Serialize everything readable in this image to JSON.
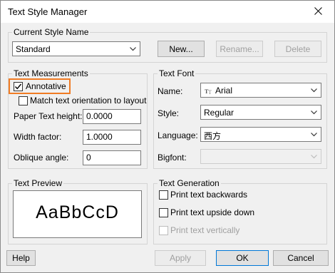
{
  "window": {
    "title": "Text Style Manager"
  },
  "icons": {
    "close": "close-icon",
    "dropdown": "chevron-down-icon",
    "check": "check-icon",
    "font": "truetype-font-icon"
  },
  "colors": {
    "highlight": "#f07c24",
    "default_button_border": "#0078d7"
  },
  "current_style": {
    "group_label": "Current Style Name",
    "selected": "Standard",
    "new_button": "New...",
    "rename_button": "Rename...",
    "delete_button": "Delete"
  },
  "text_measurements": {
    "group_label": "Text Measurements",
    "annotative": {
      "label": "Annotative",
      "checked": true
    },
    "match_orientation": {
      "label": "Match text orientation to layout",
      "checked": false
    },
    "paper_height": {
      "label": "Paper Text height:",
      "value": "0.0000"
    },
    "width_factor": {
      "label": "Width factor:",
      "value": "1.0000"
    },
    "oblique_angle": {
      "label": "Oblique angle:",
      "value": "0"
    }
  },
  "text_font": {
    "group_label": "Text Font",
    "name": {
      "label": "Name:",
      "value": "Arial"
    },
    "style": {
      "label": "Style:",
      "value": "Regular"
    },
    "language": {
      "label": "Language:",
      "value": "西方"
    },
    "bigfont": {
      "label": "Bigfont:",
      "value": ""
    }
  },
  "text_preview": {
    "group_label": "Text Preview",
    "sample": "AaBbCcD"
  },
  "text_generation": {
    "group_label": "Text Generation",
    "backwards": {
      "label": "Print text backwards",
      "checked": false
    },
    "upside_down": {
      "label": "Print text upside down",
      "checked": false
    },
    "vertically": {
      "label": "Print text vertically",
      "checked": false,
      "disabled": true
    }
  },
  "footer": {
    "help": "Help",
    "apply": "Apply",
    "ok": "OK",
    "cancel": "Cancel"
  }
}
